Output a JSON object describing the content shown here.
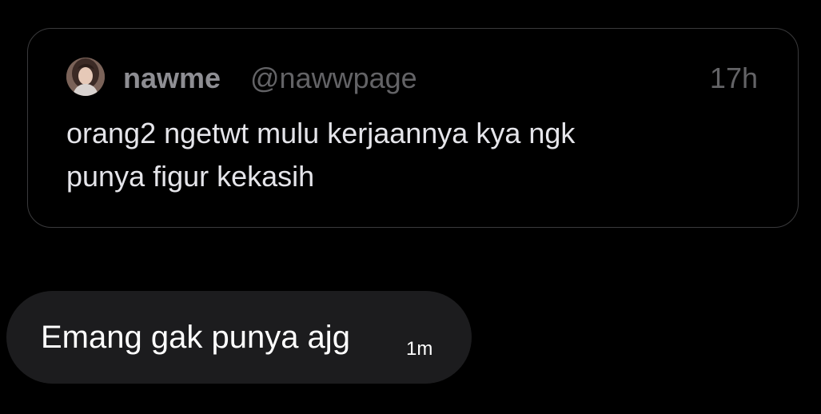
{
  "quoted_post": {
    "display_name": "nawme",
    "handle": "@nawwpage",
    "time": "17h",
    "text_lines": [
      "orang2 ngetwt mulu kerjaannya kya ngk",
      "punya figur kekasih"
    ]
  },
  "message": {
    "text": "Emang gak punya ajg",
    "time": "1m"
  },
  "colors": {
    "background": "#000000",
    "card_border": "#3a3a3c",
    "bubble": "#1c1c1e",
    "muted_text": "#8e8e93"
  }
}
